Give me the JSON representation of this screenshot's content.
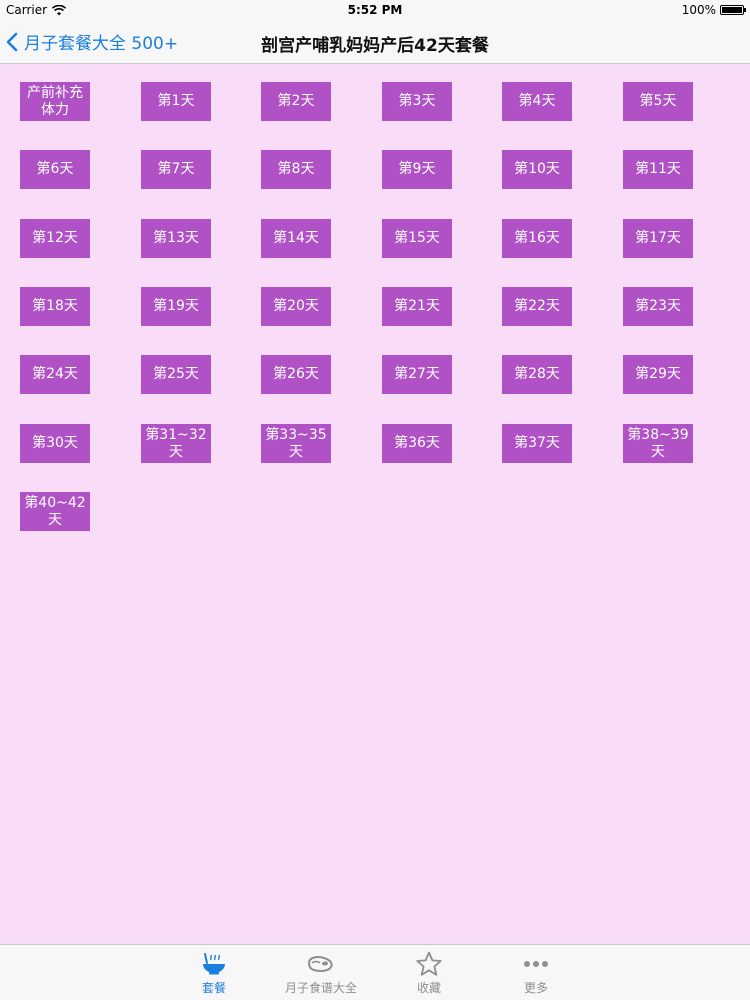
{
  "status_bar": {
    "carrier": "Carrier",
    "time": "5:52 PM",
    "battery": "100%",
    "battery_level": 1.0
  },
  "nav": {
    "back_label": "月子套餐大全 500+",
    "title": "剖宫产哺乳妈妈产后42天套餐"
  },
  "days": [
    "产前补充体力",
    "第1天",
    "第2天",
    "第3天",
    "第4天",
    "第5天",
    "第6天",
    "第7天",
    "第8天",
    "第9天",
    "第10天",
    "第11天",
    "第12天",
    "第13天",
    "第14天",
    "第15天",
    "第16天",
    "第17天",
    "第18天",
    "第19天",
    "第20天",
    "第21天",
    "第22天",
    "第23天",
    "第24天",
    "第25天",
    "第26天",
    "第27天",
    "第28天",
    "第29天",
    "第30天",
    "第31~32天",
    "第33~35天",
    "第36天",
    "第37天",
    "第38~39天",
    "第40~42天"
  ],
  "tabs": [
    {
      "label": "套餐",
      "icon": "bowl-icon",
      "active": true
    },
    {
      "label": "月子食谱大全",
      "icon": "meat-icon",
      "active": false
    },
    {
      "label": "收藏",
      "icon": "star-icon",
      "active": false
    },
    {
      "label": "更多",
      "icon": "more-dots-icon",
      "active": false
    }
  ],
  "colors": {
    "background": "#f8dcf8",
    "button": "#b052c6",
    "accent": "#1b7fe0"
  }
}
